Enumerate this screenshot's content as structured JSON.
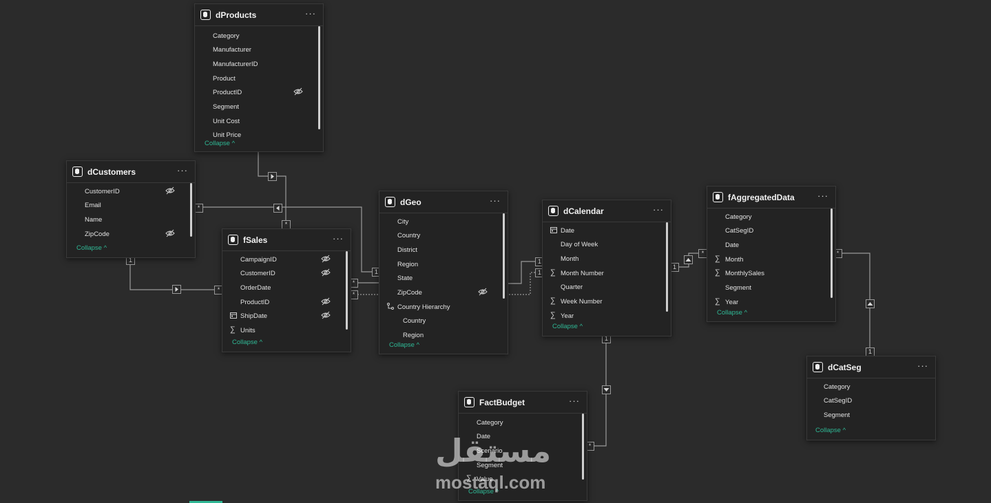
{
  "tables": {
    "dProducts": {
      "title": "dProducts",
      "more": "···",
      "collapse": "Collapse ^",
      "fields": [
        "Category",
        "Manufacturer",
        "ManufacturerID",
        "Product",
        "ProductID",
        "Segment",
        "Unit Cost",
        "Unit Price"
      ]
    },
    "dCustomers": {
      "title": "dCustomers",
      "more": "···",
      "collapse": "Collapse ^",
      "fields": [
        "CustomerID",
        "Email",
        "Name",
        "ZipCode"
      ]
    },
    "fSales": {
      "title": "fSales",
      "more": "···",
      "collapse": "Collapse ^",
      "fields": [
        "CampaignID",
        "CustomerID",
        "OrderDate",
        "ProductID",
        "ShipDate",
        "Units"
      ]
    },
    "dGeo": {
      "title": "dGeo",
      "more": "···",
      "collapse": "Collapse ^",
      "fields": [
        "City",
        "Country",
        "District",
        "Region",
        "State",
        "ZipCode",
        "Country Hierarchy",
        "Country",
        "Region"
      ]
    },
    "dCalendar": {
      "title": "dCalendar",
      "more": "···",
      "collapse": "Collapse ^",
      "fields": [
        "Date",
        "Day of Week",
        "Month",
        "Month Number",
        "Quarter",
        "Week Number",
        "Year"
      ]
    },
    "fAggregatedData": {
      "title": "fAggregatedData",
      "more": "···",
      "collapse": "Collapse ^",
      "fields": [
        "Category",
        "CatSegID",
        "Date",
        "Month",
        "MonthlySales",
        "Segment",
        "Year"
      ]
    },
    "dCatSeg": {
      "title": "dCatSeg",
      "more": "···",
      "collapse": "Collapse ^",
      "fields": [
        "Category",
        "CatSegID",
        "Segment"
      ]
    },
    "FactBudget": {
      "title": "FactBudget",
      "more": "···",
      "collapse": "Collapse ^",
      "fields": [
        "Category",
        "Date",
        "Scenario",
        "Segment",
        "Value"
      ]
    }
  },
  "markers": {
    "one": "1",
    "many": "*"
  },
  "watermark": {
    "arabic": "مستقل",
    "latin": "mostaql.com"
  },
  "colors": {
    "canvas": "#2b2b2b",
    "card": "#232323",
    "accent": "#2fb895",
    "line": "#9a9a9a"
  }
}
